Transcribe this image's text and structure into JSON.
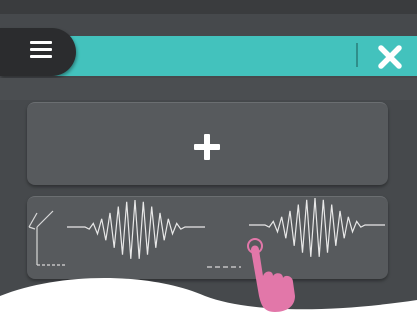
{
  "header": {
    "menu_icon": "hamburger-menu-icon",
    "close_icon": "close-x-icon",
    "accent_color": "#43c2bd"
  },
  "main": {
    "add_icon": "plus-icon",
    "waveform_card": {
      "axis_icon": "waveform-axis-icon",
      "left_waveform_icon": "waveform-icon",
      "right_waveform_icon": "waveform-icon",
      "gesture_icon": "tap-hand-icon"
    }
  }
}
